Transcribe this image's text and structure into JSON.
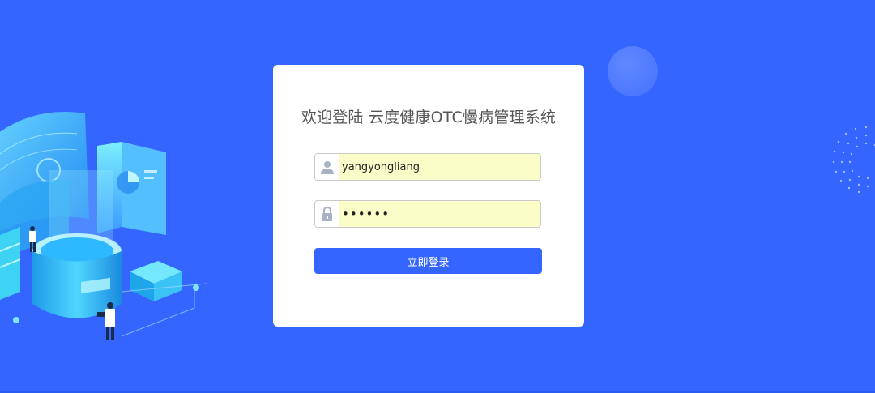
{
  "app": {
    "title": "欢迎登陆 云度健康OTC慢病管理系统"
  },
  "login": {
    "username_value": "yangyongliang",
    "password_value": "••••••",
    "submit_label": "立即登录"
  },
  "icons": {
    "username": "user-icon",
    "password": "lock-icon"
  },
  "colors": {
    "background": "#3466ff",
    "button": "#3466ff",
    "autofill": "#fbfdc8"
  }
}
